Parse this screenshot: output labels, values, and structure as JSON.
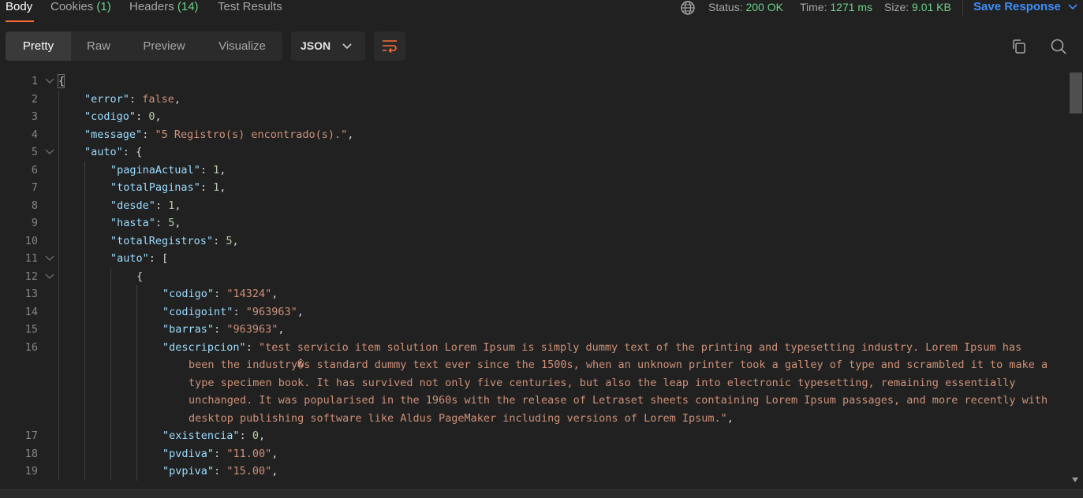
{
  "tabs": {
    "body": "Body",
    "cookies": "Cookies",
    "cookies_count": "(1)",
    "headers": "Headers",
    "headers_count": "(14)",
    "tests": "Test Results"
  },
  "status": {
    "status_label": "Status:",
    "status_value": "200 OK",
    "time_label": "Time:",
    "time_value": "1271 ms",
    "size_label": "Size:",
    "size_value": "9.01 KB"
  },
  "save_response": "Save Response",
  "view_modes": [
    "Pretty",
    "Raw",
    "Preview",
    "Visualize"
  ],
  "format": "JSON",
  "code_lines": [
    {
      "n": "1",
      "fold": true,
      "indent": 0,
      "t": "{"
    },
    {
      "n": "2",
      "fold": false,
      "indent": 1,
      "k": "error",
      "v": "false",
      "vt": "b"
    },
    {
      "n": "3",
      "fold": false,
      "indent": 1,
      "k": "codigo",
      "v": "0",
      "vt": "n"
    },
    {
      "n": "4",
      "fold": false,
      "indent": 1,
      "k": "message",
      "v": "\"5 Registro(s) encontrado(s).\"",
      "vt": "s"
    },
    {
      "n": "5",
      "fold": true,
      "indent": 1,
      "k": "auto",
      "v": "{",
      "vt": "p",
      "nocomma": true
    },
    {
      "n": "6",
      "fold": false,
      "indent": 2,
      "k": "paginaActual",
      "v": "1",
      "vt": "n"
    },
    {
      "n": "7",
      "fold": false,
      "indent": 2,
      "k": "totalPaginas",
      "v": "1",
      "vt": "n"
    },
    {
      "n": "8",
      "fold": false,
      "indent": 2,
      "k": "desde",
      "v": "1",
      "vt": "n"
    },
    {
      "n": "9",
      "fold": false,
      "indent": 2,
      "k": "hasta",
      "v": "5",
      "vt": "n"
    },
    {
      "n": "10",
      "fold": false,
      "indent": 2,
      "k": "totalRegistros",
      "v": "5",
      "vt": "n"
    },
    {
      "n": "11",
      "fold": true,
      "indent": 2,
      "k": "auto",
      "v": "[",
      "vt": "p",
      "nocomma": true
    },
    {
      "n": "12",
      "fold": true,
      "indent": 3,
      "t": "{"
    },
    {
      "n": "13",
      "fold": false,
      "indent": 4,
      "k": "codigo",
      "v": "\"14324\"",
      "vt": "s"
    },
    {
      "n": "14",
      "fold": false,
      "indent": 4,
      "k": "codigoint",
      "v": "\"963963\"",
      "vt": "s"
    },
    {
      "n": "15",
      "fold": false,
      "indent": 4,
      "k": "barras",
      "v": "\"963963\"",
      "vt": "s"
    },
    {
      "n": "16",
      "fold": false,
      "indent": 4,
      "k": "descripcion",
      "v": "\"test servicio item solution Lorem Ipsum is simply dummy text of the printing and typesetting industry. Lorem Ipsum has",
      "vt": "s",
      "nocomma": true
    },
    {
      "n": "",
      "fold": false,
      "indent": 5,
      "cont": "been the industry�s standard dummy text ever since the 1500s, when an unknown printer took a galley of type and scrambled it to make a"
    },
    {
      "n": "",
      "fold": false,
      "indent": 5,
      "cont": "type specimen book. It has survived not only five centuries, but also the leap into electronic typesetting, remaining essentially"
    },
    {
      "n": "",
      "fold": false,
      "indent": 5,
      "cont": "unchanged. It was popularised in the 1960s with the release of Letraset sheets containing Lorem Ipsum passages, and more recently with"
    },
    {
      "n": "",
      "fold": false,
      "indent": 5,
      "cont": "desktop publishing software like Aldus PageMaker including versions of Lorem Ipsum.\"",
      "comma": true
    },
    {
      "n": "17",
      "fold": false,
      "indent": 4,
      "k": "existencia",
      "v": "0",
      "vt": "n"
    },
    {
      "n": "18",
      "fold": false,
      "indent": 4,
      "k": "pvdiva",
      "v": "\"11.00\"",
      "vt": "s"
    },
    {
      "n": "19",
      "fold": false,
      "indent": 4,
      "k": "pvpiva",
      "v": "\"15.00\"",
      "vt": "s"
    }
  ],
  "colors": {
    "background": "#212121",
    "accent": "#ff6c37",
    "status_green": "#6bd089",
    "save_blue": "#3d8ef7",
    "json_key": "#9cdcfe",
    "json_string": "#ce9178",
    "json_number": "#b5cea8"
  },
  "icons": [
    "globe-icon",
    "chevron-down-icon",
    "wrap-lines-icon",
    "copy-icon",
    "search-icon",
    "fold-chevron-icon"
  ]
}
